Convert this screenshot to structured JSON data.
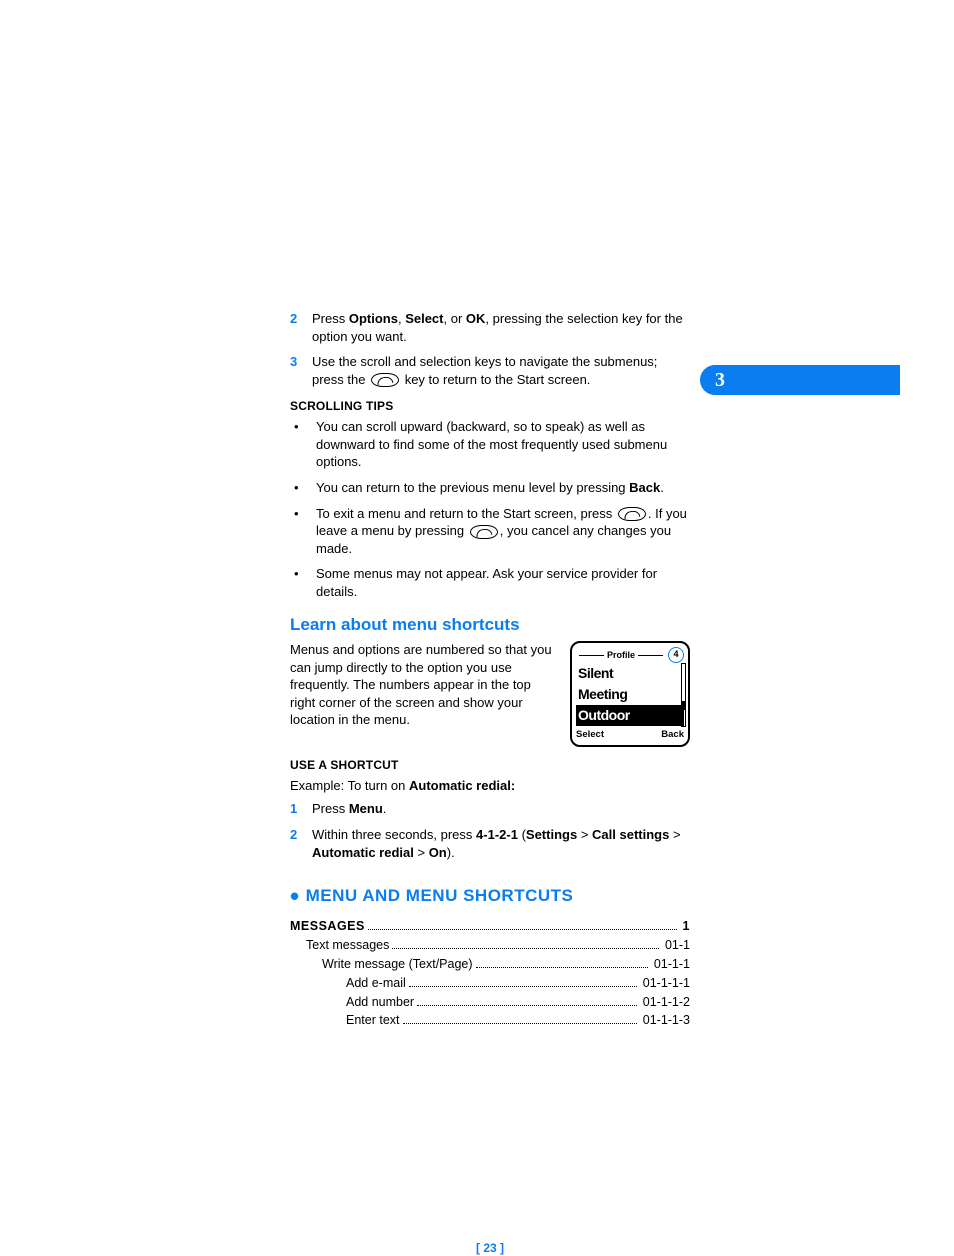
{
  "chapter_num": "3",
  "steps": {
    "s2": {
      "num": "2",
      "pre": "Press ",
      "b1": "Options",
      "sep1": ", ",
      "b2": "Select",
      "sep2": ", or ",
      "b3": "OK",
      "post": ", pressing the selection key for the option you want."
    },
    "s3": {
      "num": "3",
      "pre": "Use the scroll and selection keys to navigate the submenus; press the ",
      "post": " key to return to the Start screen."
    }
  },
  "scrolling": {
    "heading": "SCROLLING TIPS",
    "t1": "You can scroll upward (backward, so to speak) as well as downward to find some of the most frequently used submenu options.",
    "t2_pre": "You can return to the previous menu level by pressing ",
    "t2_b": "Back",
    "t2_post": ".",
    "t3_pre": "To exit a menu and return to the Start screen, press ",
    "t3_mid": ". If you leave a menu by pressing ",
    "t3_post": ", you cancel any changes you made.",
    "t4": "Some menus may not appear. Ask your service provider for details."
  },
  "learn": {
    "heading": "Learn about menu shortcuts",
    "body": "Menus and options are numbered so that you can jump directly to the option you use frequently. The numbers appear in the top right corner of the screen and show your location in the menu."
  },
  "phone": {
    "title": "Profile",
    "badge": "4",
    "i1": "Silent",
    "i2": "Meeting",
    "i3": "Outdoor",
    "left": "Select",
    "right": "Back"
  },
  "use": {
    "heading": "USE A SHORTCUT",
    "ex_pre": "Example: To turn on ",
    "ex_b": "Automatic redial:",
    "s1": {
      "num": "1",
      "pre": "Press ",
      "b": "Menu",
      "post": "."
    },
    "s2": {
      "num": "2",
      "pre": "Within three seconds, press ",
      "code": "4-1-2-1",
      "open": " (",
      "b1": "Settings",
      "gt1": " > ",
      "b2": "Call settings",
      "gt2": " > ",
      "b3": "Automatic redial",
      "gt3": " > ",
      "b4": "On",
      "close": ")."
    }
  },
  "section": "MENU AND MENU SHORTCUTS",
  "toc": {
    "r0": {
      "label": "MESSAGES",
      "pg": "1"
    },
    "r1": {
      "label": "Text messages",
      "pg": "01-1"
    },
    "r2": {
      "label": "Write message (Text/Page)",
      "pg": "01-1-1"
    },
    "r3": {
      "label": "Add e-mail",
      "pg": "01-1-1-1"
    },
    "r4": {
      "label": "Add number",
      "pg": "01-1-1-2"
    },
    "r5": {
      "label": "Enter text",
      "pg": "01-1-1-3"
    }
  },
  "footer": "[ 23 ]"
}
